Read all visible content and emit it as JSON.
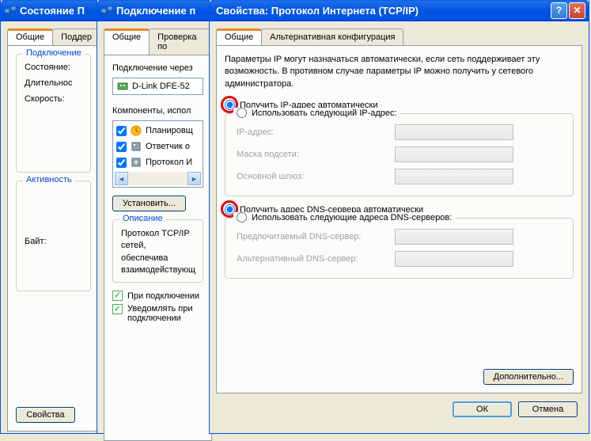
{
  "window1": {
    "title": "Состояние П",
    "tabs": {
      "general": "Общие",
      "support": "Поддер"
    },
    "conn_group": "Подключение",
    "state_label": "Состояние:",
    "duration_label": "Длительнос",
    "speed_label": "Скорость:",
    "activity_group": "Активность",
    "bytes_label": "Байт:",
    "properties_btn": "Свойства"
  },
  "window2": {
    "title": "Подключение п",
    "tabs": {
      "general": "Общие",
      "auth": "Проверка по"
    },
    "conn_via": "Подключение через",
    "adapter": "D-Link DFE-52",
    "components_label": "Компоненты, испол",
    "comp1": "Планировщ",
    "comp2": "Ответчик о",
    "comp3": "Протокол И",
    "install_btn": "Установить...",
    "desc_group": "Описание",
    "desc_text": "Протокол TCP/IP\nсетей, обеспечива\nвзаимодействующ",
    "check1": "При подключении",
    "check2": "Уведомлять при\nподключении"
  },
  "window3": {
    "title": "Свойства: Протокол Интернета (TCP/IP)",
    "tabs": {
      "general": "Общие",
      "alt": "Альтернативная конфигурация"
    },
    "intro": "Параметры IP могут назначаться автоматически, если сеть поддерживает эту возможность. В противном случае параметры IP можно получить у сетевого администратора.",
    "ip_auto": "Получить IP-адрес автоматически",
    "ip_manual": "Использовать следующий IP-адрес:",
    "ip_addr": "IP-адрес:",
    "ip_mask": "Маска подсети:",
    "ip_gw": "Основной шлюз:",
    "dns_auto": "Получить адрес DNS-сервера автоматически",
    "dns_manual": "Использовать следующие адреса DNS-серверов:",
    "dns_pref": "Предпочитаемый DNS-сервер:",
    "dns_alt": "Альтернативный DNS-сервер:",
    "advanced_btn": "Дополнительно...",
    "ok_btn": "ОК",
    "cancel_btn": "Отмена"
  }
}
